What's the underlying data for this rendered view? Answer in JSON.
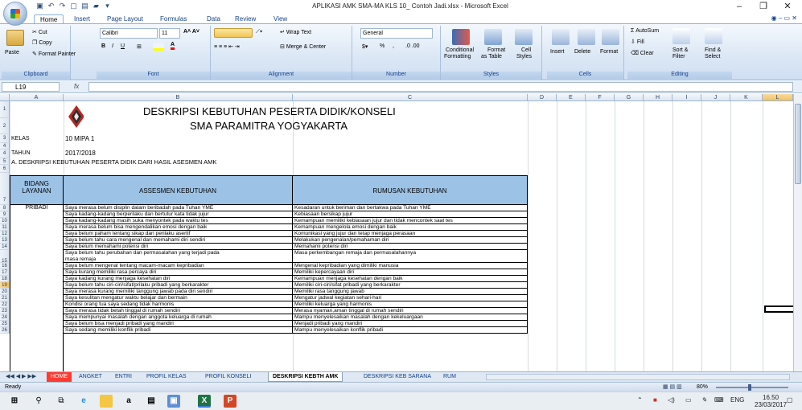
{
  "window": {
    "title": "APLIKASI AMK SMA-MA  KLS 10_ Contoh Jadi.xlsx - Microsoft Excel",
    "controls": {
      "minimize": "–",
      "restore": "❐",
      "close": "✕"
    }
  },
  "ribbon_tabs": [
    "Home",
    "Insert",
    "Page Layout",
    "Formulas",
    "Data",
    "Review",
    "View"
  ],
  "ribbon": {
    "clipboard": {
      "label": "Clipboard",
      "paste": "Paste",
      "cut": "Cut",
      "copy": "Copy",
      "format_painter": "Format Painter"
    },
    "font": {
      "label": "Font",
      "name": "Calibri",
      "size": "11"
    },
    "alignment": {
      "label": "Alignment",
      "wrap": "Wrap Text",
      "merge": "Merge & Center"
    },
    "number": {
      "label": "Number",
      "format": "General",
      "percent": "%"
    },
    "styles": {
      "label": "Styles",
      "cond": "Conditional",
      "cond2": "Formatting",
      "fmt": "Format",
      "fmt2": "as Table",
      "cell": "Cell",
      "cell2": "Styles"
    },
    "cells": {
      "label": "Cells",
      "insert": "Insert",
      "delete": "Delete",
      "format": "Format"
    },
    "editing": {
      "label": "Editing",
      "autosum": "AutoSum",
      "fill": "Fill",
      "clear": "Clear",
      "sort": "Sort &",
      "sort2": "Filter",
      "find": "Find &",
      "find2": "Select"
    }
  },
  "formula_bar": {
    "name_box": "L19",
    "fx": "fx",
    "content": ""
  },
  "columns": [
    "A",
    "B",
    "C",
    "D",
    "E",
    "F",
    "G",
    "H",
    "I",
    "J",
    "K",
    "L"
  ],
  "sheet": {
    "title1": "DESKRIPSI KEBUTUHAN PESERTA DIDIK/KONSELI",
    "title2": "SMA PARAMITRA YOGYAKARTA",
    "kelas_label": "KELAS",
    "kelas_value": "10 MIPA 1",
    "tahun_label": "TAHUN",
    "tahun_value": "2017/2018",
    "section_a": "A. DESKRIPSI KEBUTUHAN  PESERTA DIDIK DARI HASIL ASESMEN AMK",
    "header_bidang1": "BIDANG",
    "header_bidang2": "LAYANAN",
    "header_asesmen": "ASSESMEN KEBUTUHAN",
    "header_rumusan": "RUMUSAN KEBUTUHAN",
    "bidang_pribadi": "PRIBADI",
    "rows": [
      {
        "n": "8",
        "a": "Saya merasa belum disiplin dalam beribadah pada Tuhan YME",
        "r": "Kesadaran untuk beriman dan bertakwa pada Tuhan YME"
      },
      {
        "n": "9",
        "a": "Saya kadang-kadang berperilaku dan bertutur kata tidak jujur",
        "r": "Kebiasaan bersikap jujur"
      },
      {
        "n": "10",
        "a": "Saya kadang-kadang masih suka menyontek pada waktu tes",
        "r": "Kemampuan memiliki kebiasaan jujur dan tidak mencontek saat tes"
      },
      {
        "n": "11",
        "a": "Saya merasa belum bisa mengendalikan emosi dengan baik",
        "r": "Kemampuan mengelola emosi dengan baik"
      },
      {
        "n": "12",
        "a": "Saya belum paham tentang sikap dan perilaku asertif",
        "r": "Komunikasi yang jujur dan tetap menjaga perasaan"
      },
      {
        "n": "13",
        "a": "Saya belum tahu cara mengenal dan memahami diri sendiri",
        "r": "Melakukan pengenalan/pemahaman diri"
      },
      {
        "n": "14",
        "a": "Saya belum memahami potensi diri",
        "r": "Memahami potensi diri"
      },
      {
        "n": "15",
        "a": "Saya belum tahu perubahan dan permasalahan yang terjadi pada",
        "a2": "masa remaja",
        "r": "Masa perkembangan remaja dan permasalahannya"
      },
      {
        "n": "16",
        "a": "Saya belum mengenal tentang macam-macam kepribadian",
        "r": "Mengenal kepribadian yang dimiliki manusia"
      },
      {
        "n": "17",
        "a": "Saya kurang memiliki rasa percaya diri",
        "r": "Memiliki kepercayaan diri"
      },
      {
        "n": "18",
        "a": "Saya kadang kurang menjaga kesehatan diri",
        "r": "Kemampuan menjaga kesehatan dengan baik"
      },
      {
        "n": "19",
        "a": "Saya belum tahu ciri-ciri/sifat/prilaku pribadi yang berkarakter",
        "r": "Memiliki ciri-ciri/sifat pribadi yang berkarakter"
      },
      {
        "n": "20",
        "a": "Saya merasa kurang memiliki tanggung jawab  pada diri sendiri",
        "r": "Memiliki rasa tanggung jawab"
      },
      {
        "n": "21",
        "a": "Saya kesulitan mengatur waktu belajar dan bermain",
        "r": "Mengatur jadwal kegiatan sehari-hari"
      },
      {
        "n": "22",
        "a": "Kondisi orang tua saya sedang tidak harmonis",
        "r": "Memiliki keluarga yang harmonis"
      },
      {
        "n": "23",
        "a": "Saya merasa tidak betah tinggal di rumah sendiri",
        "r": "Merasa nyaman,aman tinggal di rumah sendiri"
      },
      {
        "n": "24",
        "a": "Saya mempunyai masalah dengan anggota keluarga di rumah",
        "r": "Mampu menyelesaikan masalah dengan kekeluargaan"
      },
      {
        "n": "25",
        "a": "Saya  belum bisa menjadi pribadi yang mandiri",
        "r": "Menjadi pribadi yang mandiri"
      },
      {
        "n": "26",
        "a": "Saya sedang memiliki konflik pribadi",
        "r": "Mampu menyelesaikan konflik pribadi"
      }
    ]
  },
  "sheet_tabs": [
    "HOME",
    "ANGKET",
    "ENTRI",
    "PROFIL KELAS",
    "PROFIL KONSELI",
    "DESKRIPSI KEBTH AMK",
    "DESKRIPSI KEB SARANA",
    "RUM"
  ],
  "status": {
    "ready": "Ready",
    "zoom": "80%"
  },
  "taskbar": {
    "lang": "ENG",
    "time": "16.50",
    "date": "23/03/2017"
  }
}
